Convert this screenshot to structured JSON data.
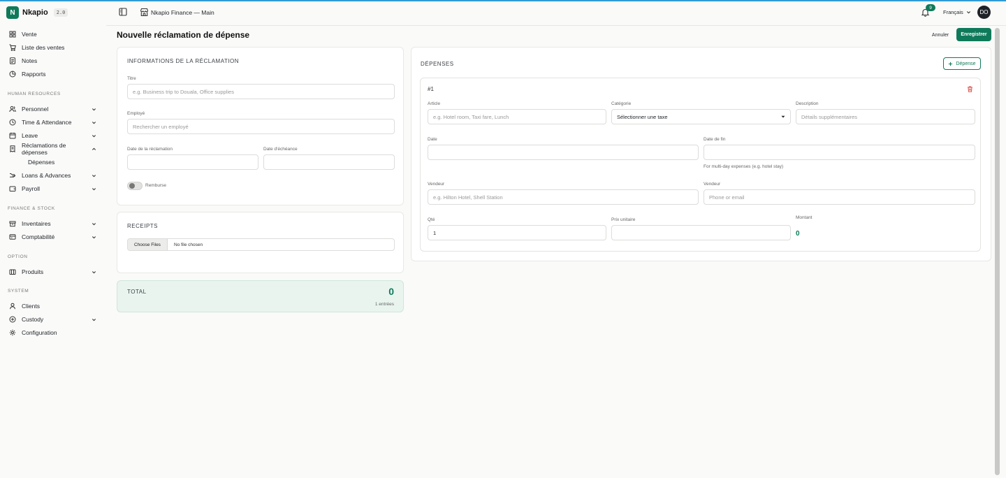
{
  "brand": {
    "initial": "N",
    "name": "Nkapio",
    "version": "2.0"
  },
  "sidebar": {
    "top_items": [
      {
        "label": "Vente",
        "icon": "grid-icon"
      },
      {
        "label": "Liste des ventes",
        "icon": "cart-icon"
      },
      {
        "label": "Notes",
        "icon": "note-icon"
      },
      {
        "label": "Rapports",
        "icon": "chart-icon"
      }
    ],
    "section_hr": "HUMAN RESOURCES",
    "hr_items": [
      {
        "label": "Personnel",
        "icon": "users-icon"
      },
      {
        "label": "Time & Attendance",
        "icon": "clock-icon"
      },
      {
        "label": "Leave",
        "icon": "calendar-icon"
      },
      {
        "label": "Réclamations de dépenses",
        "icon": "receipt-icon"
      },
      {
        "label": "Dépenses"
      },
      {
        "label": "Loans & Advances",
        "icon": "money-icon"
      },
      {
        "label": "Payroll",
        "icon": "wallet-icon"
      }
    ],
    "section_finance": "FINANCE & STOCK",
    "finance_items": [
      {
        "label": "Inventaires",
        "icon": "box-icon"
      },
      {
        "label": "Comptabilité",
        "icon": "bank-icon"
      }
    ],
    "section_option": "OPTION",
    "option_items": [
      {
        "label": "Produits",
        "icon": "package-icon"
      }
    ],
    "section_system": "SYSTEM",
    "system_items": [
      {
        "label": "Clients",
        "icon": "user-icon"
      },
      {
        "label": "Custody",
        "icon": "shield-icon"
      },
      {
        "label": "Configuration",
        "icon": "gear-icon"
      }
    ]
  },
  "header": {
    "title": "Nkapio Finance — Main",
    "notifications": "9",
    "language": "Français",
    "avatar": "DO"
  },
  "page": {
    "title": "Nouvelle réclamation de dépense",
    "cancel": "Annuler",
    "save": "Enregistrer"
  },
  "claim": {
    "title": "INFORMATIONS DE LA RÉCLAMATION",
    "titre_label": "Titre",
    "titre_placeholder": "e.g. Business trip to Douala, Office supplies",
    "employe_label": "Employé",
    "employe_placeholder": "Rechercher un employé",
    "date_label": "Date de la réclamation",
    "due_label": "Date d'échéance",
    "reimbursed_label": "Remburse"
  },
  "receipts": {
    "title": "RECEIPTS",
    "choose": "Choose Files",
    "none": "No file chosen"
  },
  "total": {
    "label": "TOTAL",
    "value": "0",
    "entries": "1 entrées"
  },
  "expenses": {
    "title": "DÉPENSES",
    "add_label": "Dépense",
    "item_number": "#1",
    "article_label": "Article",
    "article_placeholder": "e.g. Hotel room, Taxi fare, Lunch",
    "category_label": "Catégorie",
    "category_value": "Sélectionner une taxe",
    "description_label": "Description",
    "description_placeholder": "Détails supplémentaires",
    "date_label": "Date",
    "end_date_label": "Date de fin",
    "end_date_hint": "For multi-day expenses (e.g. hotel stay)",
    "vendor_label": "Vendeur",
    "vendor_placeholder": "e.g. Hilton Hotel, Shell Station",
    "vendor_contact_label": "Vendeur",
    "vendor_contact_placeholder": "Phone or email",
    "qty_label": "Qté",
    "qty_value": "1",
    "unit_price_label": "Prix unitaire",
    "amount_label": "Montant",
    "amount_value": "0"
  },
  "colors": {
    "accent": "#0f7a5a",
    "top_bar": "#2f9bd6",
    "danger": "#d9534f"
  }
}
